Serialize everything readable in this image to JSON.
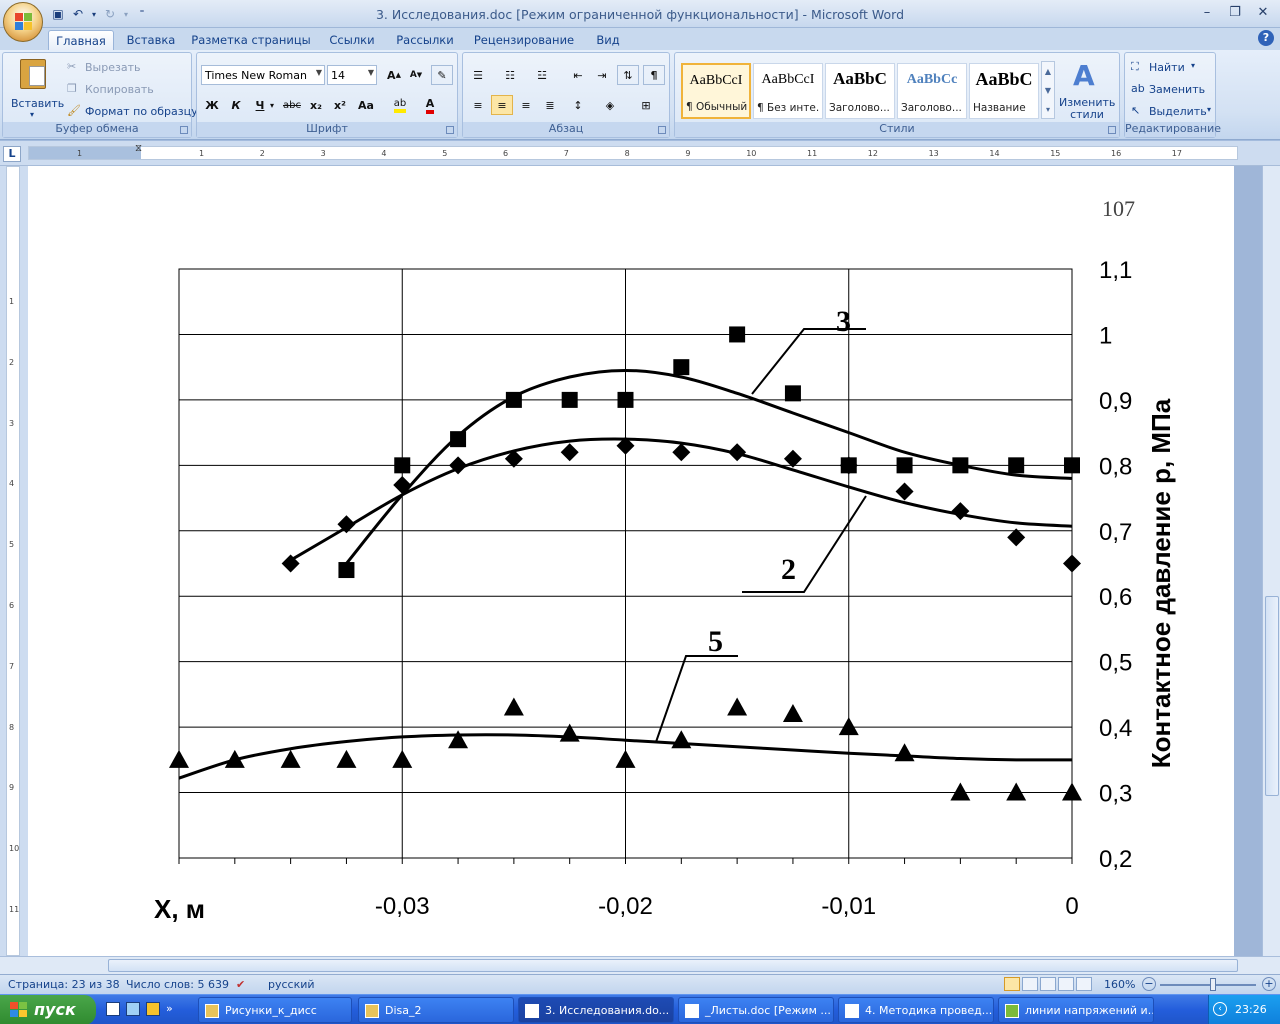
{
  "window": {
    "title": "3. Исследования.doc [Режим ограниченной функциональности] - Microsoft Word"
  },
  "tabs": [
    "Главная",
    "Вставка",
    "Разметка страницы",
    "Ссылки",
    "Рассылки",
    "Рецензирование",
    "Вид"
  ],
  "clipboard": {
    "paste": "Вставить",
    "cut": "Вырезать",
    "copy": "Копировать",
    "format_painter": "Формат по образцу",
    "label": "Буфер обмена"
  },
  "font": {
    "name": "Times New Roman",
    "size": "14",
    "label": "Шрифт",
    "bold": "Ж",
    "italic": "К",
    "underline": "Ч",
    "strike": "abc",
    "sub": "x₂",
    "sup": "x²",
    "case": "Aa"
  },
  "paragraph": {
    "label": "Абзац"
  },
  "styles": {
    "items": [
      {
        "preview": "AaBbCcI",
        "name": "¶ Обычный"
      },
      {
        "preview": "AaBbCcI",
        "name": "¶ Без инте..."
      },
      {
        "preview": "AaBbC",
        "name": "Заголово..."
      },
      {
        "preview": "AaBbCc",
        "name": "Заголово..."
      },
      {
        "preview": "AaBbC",
        "name": "Название"
      }
    ],
    "change": "Изменить стили",
    "label": "Стили"
  },
  "editing": {
    "find": "Найти",
    "replace": "Заменить",
    "select": "Выделить",
    "label": "Редактирование"
  },
  "ruler": {
    "numbers": [
      "1",
      "1",
      "2",
      "3",
      "4",
      "5",
      "6",
      "7",
      "8",
      "9",
      "10",
      "11",
      "12",
      "13",
      "14",
      "15",
      "16",
      "17"
    ]
  },
  "document": {
    "page_number": "107"
  },
  "chart_data": {
    "type": "scatter",
    "xlabel": "X, м",
    "ylabel": "Контактное давление р, МПа",
    "x_ticks": [
      "-0,03",
      "-0,02",
      "-0,01",
      "0"
    ],
    "y_ticks": [
      "0,2",
      "0,3",
      "0,4",
      "0,5",
      "0,6",
      "0,7",
      "0,8",
      "0,9",
      "1",
      "1,1"
    ],
    "xlim": [
      -0.04,
      0
    ],
    "ylim": [
      0.2,
      1.1
    ],
    "series": [
      {
        "name": "3",
        "marker": "square",
        "x": [
          -0.0325,
          -0.03,
          -0.0275,
          -0.025,
          -0.0225,
          -0.02,
          -0.0175,
          -0.015,
          -0.0125,
          -0.01,
          -0.0075,
          -0.005,
          -0.0025,
          0
        ],
        "y": [
          0.64,
          0.8,
          0.84,
          0.9,
          0.9,
          0.9,
          0.95,
          1.0,
          0.91,
          0.8,
          0.8,
          0.8,
          0.8,
          0.8
        ],
        "fit_x": [
          -0.0325,
          -0.03,
          -0.0275,
          -0.025,
          -0.0225,
          -0.02,
          -0.0175,
          -0.015,
          -0.0125,
          -0.01,
          -0.0075,
          -0.005,
          -0.0025,
          0
        ],
        "fit_y": [
          0.65,
          0.755,
          0.845,
          0.905,
          0.935,
          0.945,
          0.935,
          0.91,
          0.88,
          0.85,
          0.82,
          0.8,
          0.785,
          0.78
        ]
      },
      {
        "name": "2",
        "marker": "diamond",
        "x": [
          -0.035,
          -0.0325,
          -0.03,
          -0.0275,
          -0.025,
          -0.0225,
          -0.02,
          -0.0175,
          -0.015,
          -0.0125,
          -0.01,
          -0.0075,
          -0.005,
          -0.0025,
          0
        ],
        "y": [
          0.65,
          0.71,
          0.77,
          0.8,
          0.81,
          0.82,
          0.83,
          0.82,
          0.82,
          0.81,
          0.8,
          0.76,
          0.73,
          0.69,
          0.65
        ],
        "fit_x": [
          -0.035,
          -0.0325,
          -0.03,
          -0.0275,
          -0.025,
          -0.0225,
          -0.02,
          -0.0175,
          -0.015,
          -0.0125,
          -0.01,
          -0.0075,
          -0.005,
          -0.0025,
          0
        ],
        "fit_y": [
          0.655,
          0.705,
          0.755,
          0.795,
          0.822,
          0.837,
          0.84,
          0.834,
          0.818,
          0.793,
          0.767,
          0.743,
          0.725,
          0.712,
          0.707
        ]
      },
      {
        "name": "5",
        "marker": "triangle",
        "x": [
          -0.04,
          -0.0375,
          -0.035,
          -0.0325,
          -0.03,
          -0.0275,
          -0.025,
          -0.0225,
          -0.02,
          -0.0175,
          -0.015,
          -0.0125,
          -0.01,
          -0.0075,
          -0.005,
          -0.0025,
          0
        ],
        "y": [
          0.35,
          0.35,
          0.35,
          0.35,
          0.35,
          0.38,
          0.43,
          0.39,
          0.35,
          0.38,
          0.43,
          0.42,
          0.4,
          0.36,
          0.3,
          0.3,
          0.3
        ],
        "fit_x": [
          -0.04,
          -0.0375,
          -0.035,
          -0.0325,
          -0.03,
          -0.0275,
          -0.025,
          -0.0225,
          -0.02,
          -0.0175,
          -0.015,
          -0.0125,
          -0.01,
          -0.0075,
          -0.005,
          -0.0025,
          0
        ],
        "fit_y": [
          0.322,
          0.35,
          0.367,
          0.378,
          0.385,
          0.388,
          0.388,
          0.385,
          0.38,
          0.375,
          0.37,
          0.365,
          0.36,
          0.356,
          0.352,
          0.35,
          0.35
        ]
      }
    ],
    "grid": true
  },
  "status": {
    "page": "Страница: 23 из 38",
    "words": "Число слов: 5 639",
    "language": "русский",
    "zoom": "160%"
  },
  "taskbar": {
    "start": "пуск",
    "items": [
      "Рисунки_к_дисс",
      "Disa_2",
      "3. Исследования.do...",
      "_Листы.doc [Режим ...",
      "4. Методика провед...",
      "линии напряжений и..."
    ],
    "clock": "23:26"
  }
}
